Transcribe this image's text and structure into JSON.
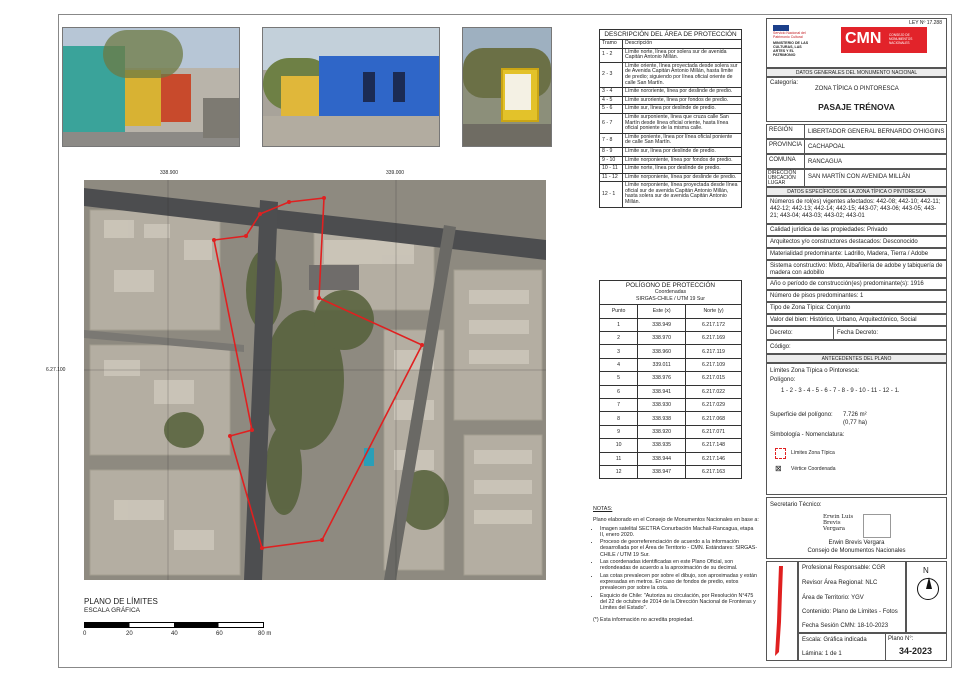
{
  "law": "LEY Nº 17.288",
  "logos": {
    "ministry_top": "Servicio Nacional del Patrimonio Cultural",
    "ministry": "MINISTERIO DE LAS CULTURAS, LAS ARTES Y EL PATRIMONIO",
    "cmn": "CMN",
    "cmn_sub": "CONSEJO DE MONUMENTOS NACIONALES"
  },
  "general": {
    "header": "DATOS GENERALES DEL MONUMENTO NACIONAL",
    "category_label": "Categoría:",
    "category_value": "ZONA TÍPICA O PINTORESCA",
    "name": "PASAJE TRÉNOVA",
    "region_label": "REGIÓN",
    "region_value": "LIBERTADOR GENERAL BERNARDO O'HIGGINS",
    "province_label": "PROVINCIA",
    "province_value": "CACHAPOAL",
    "commune_label": "COMUNA",
    "commune_value": "RANCAGUA",
    "address_label": "DIRECCIÓN UBICACIÓN LUGAR",
    "address_value": "SAN MARTÍN CON AVENIDA MILLÁN"
  },
  "specific": {
    "header": "DATOS ESPECÍFICOS DE LA ZONA TÍPICA O PINTORESCA",
    "rows": [
      "Números de rol(es) vigentes afectados: 442-08; 442-10; 442-11; 442-12; 442-13; 442-14; 442-15; 443-07; 443-06; 443-05; 443-21; 443-04; 443-03; 443-02; 443-01",
      "Calidad jurídica de las propiedades: Privado",
      "Arquitectos y/o constructores destacados: Desconocido",
      "Materialidad predominante: Ladrillo, Madera, Tierra / Adobe",
      "Sistema constructivo: Mixto, Albañilería de adobe y tabiquería de madera con adobillo",
      "Año o período de construcción(es) predominante(s): 1916",
      "Número de pisos predominantes: 1",
      "Tipo de Zona Típica: Conjunto",
      "Valor del bien: Histórico, Urbano, Arquitectónico, Social"
    ],
    "decree_label": "Decreto:",
    "decree_date_label": "Fecha Decreto:",
    "code_label": "Código:"
  },
  "plan_antecedents": {
    "header": "ANTECEDENTES DEL PLANO",
    "limits_label": "Límites Zona Típica o Pintoresca:",
    "polygon_label": "Polígono:",
    "polygon_value": "1 - 2 - 3 - 4 - 5 - 6 - 7 - 8 - 9 - 10 - 11 - 12 - 1.",
    "area_label": "Superficie del polígono:",
    "area_value": "7.726 m²",
    "area_ha": "(0,77 ha)",
    "legend_label": "Simbología - Nomenclatura:",
    "legend_limits": "Límites Zona Típica",
    "legend_vertex": "Vértice Coordenada"
  },
  "technical": {
    "secretary_label": "Secretario Técnico:",
    "signature": "Erwin Luis Brevis Vergara",
    "signer_name": "Erwin Brevis Vergara",
    "signer_org": "Consejo de Monumentos Nacionales",
    "professional": "Profesional Responsable: CGR",
    "reviewer": "Revisor Área Regional: NLC",
    "territory": "Área de Territorio: YGV",
    "content": "Contenido: Plano de Límites - Fotos",
    "session": "Fecha Sesión CMN: 18-10-2023",
    "scale": "Escala: Gráfica indicada",
    "sheet": "Lámina: 1 de 1",
    "plan_label": "Plano N°:",
    "plan_number": "34-2023",
    "north": "N"
  },
  "description": {
    "title": "DESCRIPCIÓN DEL ÁREA DE PROTECCIÓN",
    "col_tramo": "Tramo",
    "col_desc": "Descripción",
    "rows": [
      {
        "tramo": "1 - 2",
        "desc": "Límite norte, línea por solera sur de avenida Capitán Antonio Millán."
      },
      {
        "tramo": "2 - 3",
        "desc": "Límite oriente, línea proyectada desde solera sur de Avenida Capitán Antonio Millán, hasta límite de predio; siguiendo por línea oficial oriente de calle San Martín."
      },
      {
        "tramo": "3 - 4",
        "desc": "Límite nororiente, línea por deslinde de predio."
      },
      {
        "tramo": "4 - 5",
        "desc": "Límite suroriente, línea por fondos de predio."
      },
      {
        "tramo": "5 - 6",
        "desc": "Límite sur, línea por deslinde de predio."
      },
      {
        "tramo": "6 - 7",
        "desc": "Límite surponiente, línea que cruza calle San Martín desde línea oficial oriente, hasta línea oficial poniente de la misma calle."
      },
      {
        "tramo": "7 - 8",
        "desc": "Límite poniente, línea por línea oficial poniente de calle San Martín."
      },
      {
        "tramo": "8 - 9",
        "desc": "Límite sur, línea por deslinde de predio."
      },
      {
        "tramo": "9 - 10",
        "desc": "Límite norponiente, línea por fondos de predio."
      },
      {
        "tramo": "10 - 11",
        "desc": "Límite norte, línea por deslinde de predio."
      },
      {
        "tramo": "11 - 12",
        "desc": "Límite norponiente, línea por deslinde de predio."
      },
      {
        "tramo": "12 - 1",
        "desc": "Límite norponiente, línea proyectada desde línea oficial sur de avenida Capitán Antonio Millán, hasta solera sur de avenida Capitán Antonio Millán."
      }
    ]
  },
  "polygon": {
    "title": "POLÍGONO DE PROTECCIÓN",
    "subtitle1": "Coordenadas",
    "subtitle2": "SIRGAS-CHILE / UTM 19 Sur",
    "col_point": "Punto",
    "col_east": "Este (x)",
    "col_north": "Norte (y)",
    "rows": [
      {
        "p": "1",
        "x": "338.949",
        "y": "6.217.172"
      },
      {
        "p": "2",
        "x": "338.970",
        "y": "6.217.169"
      },
      {
        "p": "3",
        "x": "338.960",
        "y": "6.217.119"
      },
      {
        "p": "4",
        "x": "339.011",
        "y": "6.217.109"
      },
      {
        "p": "5",
        "x": "338.976",
        "y": "6.217.015"
      },
      {
        "p": "6",
        "x": "338.941",
        "y": "6.217.022"
      },
      {
        "p": "7",
        "x": "338.930",
        "y": "6.217.029"
      },
      {
        "p": "8",
        "x": "338.938",
        "y": "6.217.068"
      },
      {
        "p": "9",
        "x": "338.920",
        "y": "6.217.071"
      },
      {
        "p": "10",
        "x": "338.935",
        "y": "6.217.148"
      },
      {
        "p": "11",
        "x": "338.944",
        "y": "6.217.146"
      },
      {
        "p": "12",
        "x": "338.947",
        "y": "6.217.163"
      }
    ]
  },
  "notes": {
    "title": "NOTAS:",
    "intro": "Plano elaborado en el Consejo de Monumentos Nacionales en base a:",
    "items": [
      "Imagen satelital SECTRA Conurbación Machalí-Rancagua, etapa II, enero 2020.",
      "Proceso de georreferenciación de acuerdo a la información desarrollada por el Área de Territorio - CMN. Estándares: SIRGAS-CHILE / UTM 19 Sur.",
      "Las coordenadas identificadas en este Plano Oficial, son redondeadas de acuerdo a la aproximación de su decimal.",
      "Las cotas prevalecen por sobre el dibujo, son aproximadas y están expresadas en metros. En caso de fondos de predio, estos prevalecen por sobre la cota.",
      "Esquicio de Chile: \"Autoriza su circulación, por Resolución N°475 del 22 de octubre de 2014 de la Dirección Nacional de Fronteras y Límites del Estado\"."
    ],
    "footnote": "(*) Esta información no acredita propiedad."
  },
  "map": {
    "coord_top_left": "338.900",
    "coord_top_right": "339.000",
    "coord_left": "6.27.100",
    "title": "PLANO DE LÍMITES",
    "scale_title": "ESCALA GRÁFICA",
    "scale_ticks": [
      "0",
      "20",
      "40",
      "60",
      "80 m"
    ]
  }
}
